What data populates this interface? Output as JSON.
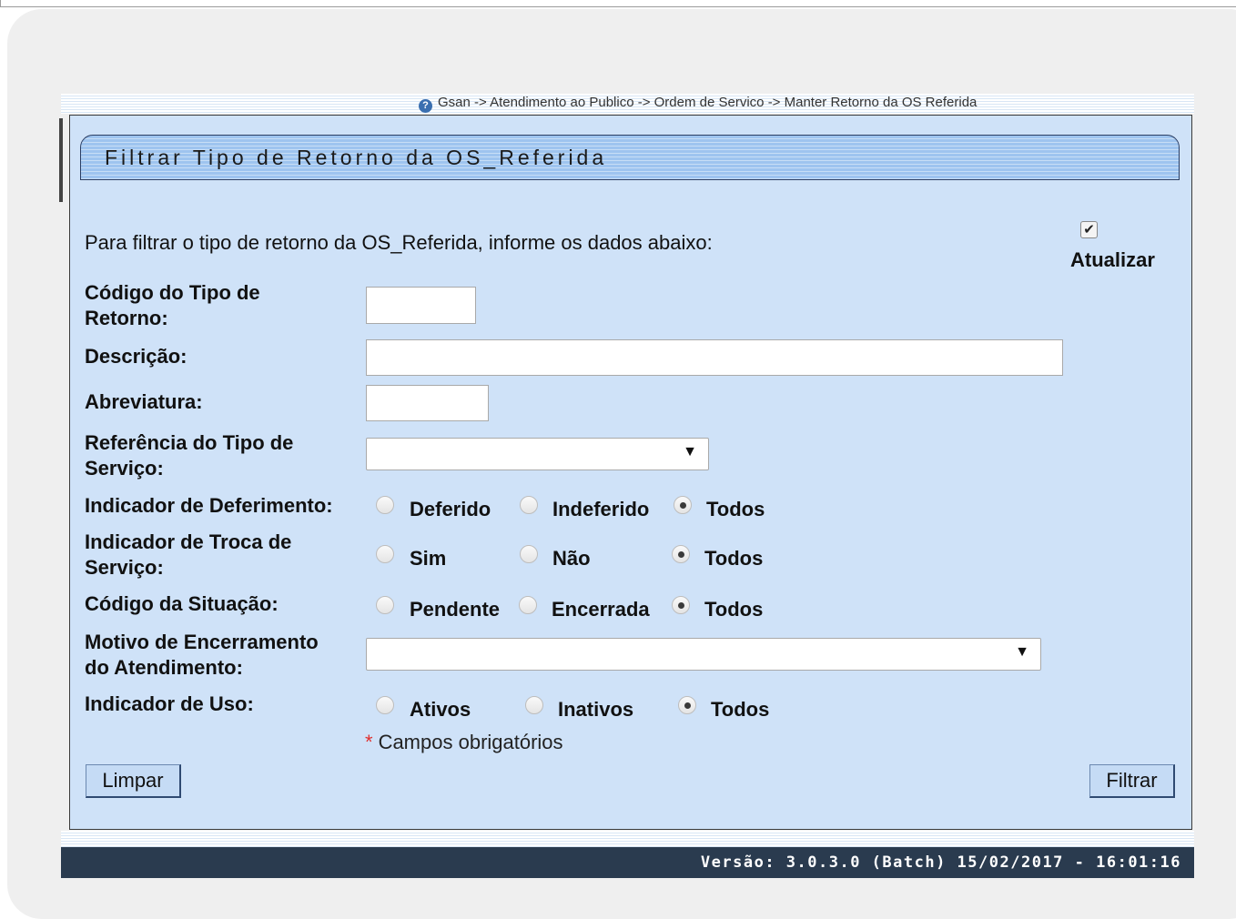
{
  "breadcrumb": "Gsan -> Atendimento ao Publico -> Ordem de Servico -> Manter Retorno da OS Referida",
  "form_title": "Filtrar Tipo de Retorno da OS_Referida",
  "intro": "Para filtrar o tipo de retorno da OS_Referida, informe os dados abaixo:",
  "update": {
    "label": "Atualizar",
    "checked": true
  },
  "fields": {
    "codigo_tipo_retorno": {
      "label_line1": "Código do Tipo de",
      "label_line2": "Retorno:",
      "value": ""
    },
    "descricao": {
      "label": "Descrição:",
      "value": ""
    },
    "abreviatura": {
      "label": "Abreviatura:",
      "value": ""
    },
    "referencia_tipo_servico": {
      "label_line1": "Referência do Tipo de",
      "label_line2": "Serviço:",
      "selected": ""
    },
    "indicador_deferimento": {
      "label": "Indicador de Deferimento:",
      "options": [
        "Deferido",
        "Indeferido",
        "Todos"
      ],
      "selected": "Todos"
    },
    "indicador_troca_servico": {
      "label_line1": "Indicador de Troca de",
      "label_line2": "Serviço:",
      "options": [
        "Sim",
        "Não",
        "Todos"
      ],
      "selected": "Todos"
    },
    "codigo_situacao": {
      "label": "Código da Situação:",
      "options": [
        "Pendente",
        "Encerrada",
        "Todos"
      ],
      "selected": "Todos"
    },
    "motivo_encerramento": {
      "label_line1": "Motivo de Encerramento",
      "label_line2": "do Atendimento:",
      "selected": ""
    },
    "indicador_uso": {
      "label": "Indicador de Uso:",
      "options": [
        "Ativos",
        "Inativos",
        "Todos"
      ],
      "selected": "Todos"
    }
  },
  "required_note": "Campos obrigatórios",
  "required_mark": "*",
  "buttons": {
    "clear": "Limpar",
    "filter": "Filtrar"
  },
  "footer": "Versão: 3.0.3.0 (Batch) 15/02/2017 - 16:01:16"
}
